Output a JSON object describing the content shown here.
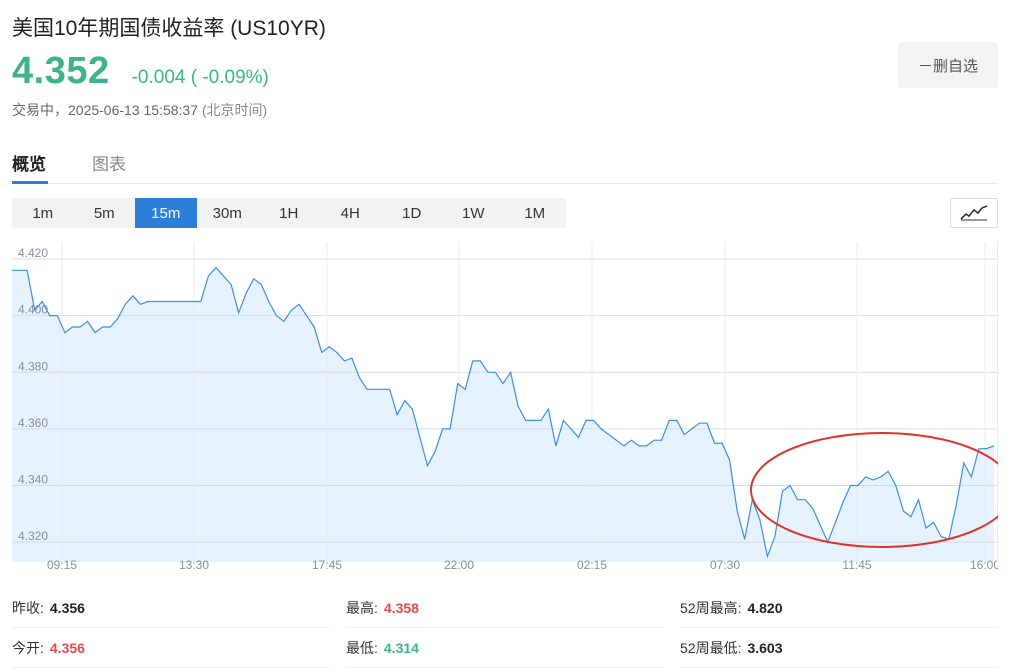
{
  "header": {
    "title": "美国10年期国债收益率 (US10YR)",
    "price": "4.352",
    "change": "-0.004 ( -0.09%)",
    "status": "交易中，2025-06-13 15:58:37",
    "timezone": "(北京时间)",
    "remove_watchlist": "－删自选"
  },
  "tabs": [
    {
      "label": "概览",
      "active": true
    },
    {
      "label": "图表",
      "active": false
    }
  ],
  "intervals": [
    {
      "label": "1m",
      "active": false
    },
    {
      "label": "5m",
      "active": false
    },
    {
      "label": "15m",
      "active": true
    },
    {
      "label": "30m",
      "active": false
    },
    {
      "label": "1H",
      "active": false
    },
    {
      "label": "4H",
      "active": false
    },
    {
      "label": "1D",
      "active": false
    },
    {
      "label": "1W",
      "active": false
    },
    {
      "label": "1M",
      "active": false
    }
  ],
  "chart_type_icon": "line-chart-icon",
  "colors": {
    "up": "#e8494c",
    "down": "#3db38a",
    "accent": "#2b7fd9",
    "line": "#3b8fe0",
    "area": "#e6f2fd",
    "annotation": "#e0332b"
  },
  "chart_data": {
    "type": "area",
    "y_ticks": [
      "4.420",
      "4.400",
      "4.380",
      "4.360",
      "4.340",
      "4.320"
    ],
    "x_ticks": [
      "09:15",
      "13:30",
      "17:45",
      "22:00",
      "02:15",
      "07:30",
      "11:45",
      "16:00"
    ],
    "ylim": [
      4.313,
      4.426
    ],
    "grid": true,
    "annotation": "red ellipse around the most recent segment (07:30–16:00)",
    "values": [
      4.416,
      4.416,
      4.416,
      4.402,
      4.405,
      4.4,
      4.4,
      4.394,
      4.396,
      4.396,
      4.398,
      4.394,
      4.396,
      4.396,
      4.399,
      4.404,
      4.407,
      4.404,
      4.405,
      4.405,
      4.405,
      4.405,
      4.405,
      4.405,
      4.405,
      4.405,
      4.414,
      4.417,
      4.414,
      4.411,
      4.401,
      4.408,
      4.413,
      4.411,
      4.405,
      4.4,
      4.398,
      4.402,
      4.404,
      4.4,
      4.396,
      4.387,
      4.389,
      4.387,
      4.384,
      4.385,
      4.378,
      4.374,
      4.374,
      4.374,
      4.374,
      4.365,
      4.37,
      4.367,
      4.357,
      4.347,
      4.352,
      4.36,
      4.36,
      4.376,
      4.374,
      4.384,
      4.384,
      4.38,
      4.38,
      4.376,
      4.38,
      4.368,
      4.363,
      4.363,
      4.363,
      4.367,
      4.354,
      4.363,
      4.36,
      4.357,
      4.363,
      4.363,
      4.36,
      4.358,
      4.356,
      4.354,
      4.356,
      4.354,
      4.354,
      4.356,
      4.356,
      4.363,
      4.363,
      4.358,
      4.36,
      4.362,
      4.362,
      4.355,
      4.355,
      4.349,
      4.331,
      4.321,
      4.335,
      4.328,
      4.315,
      4.322,
      4.338,
      4.34,
      4.335,
      4.335,
      4.332,
      4.326,
      4.32,
      4.327,
      4.334,
      4.34,
      4.34,
      4.343,
      4.342,
      4.343,
      4.345,
      4.34,
      4.331,
      4.329,
      4.335,
      4.325,
      4.327,
      4.322,
      4.321,
      4.333,
      4.348,
      4.343,
      4.353,
      4.353,
      4.354
    ]
  },
  "stats": [
    {
      "label": "昨收:",
      "value": "4.356",
      "tone": "dark"
    },
    {
      "label": "最高:",
      "value": "4.358",
      "tone": "red"
    },
    {
      "label": "52周最高:",
      "value": "4.820",
      "tone": "dark"
    },
    {
      "label": "今开:",
      "value": "4.356",
      "tone": "red"
    },
    {
      "label": "最低:",
      "value": "4.314",
      "tone": "green"
    },
    {
      "label": "52周最低:",
      "value": "3.603",
      "tone": "dark"
    }
  ]
}
